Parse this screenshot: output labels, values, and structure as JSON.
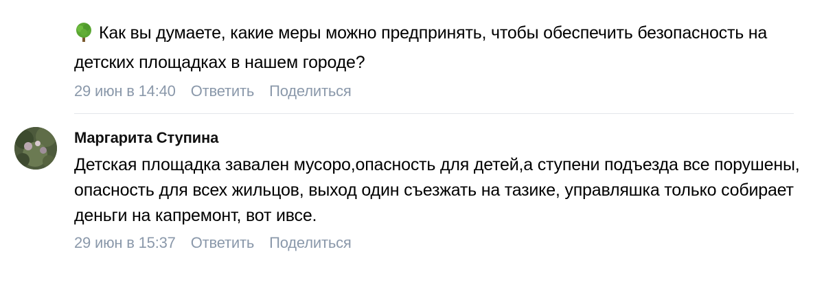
{
  "first_comment": {
    "icon": "tree-icon",
    "text": "Как вы думаете, какие меры можно предпринять, чтобы обеспечить безопасность на детских площадках в нашем городе?",
    "date": "29 июн в 14:40",
    "reply_label": "Ответить",
    "share_label": "Поделиться"
  },
  "second_comment": {
    "author": "Маргарита Ступина",
    "avatar_icon": "avatar-photo",
    "text": "Детская площадка завален мусоро,опасность для детей,а ступени подъезда все порушены, опасность для всех жильцов, выход один съезжать на тазике, управляшка только собирает деньги на капремонт, вот ивсе.",
    "date": "29 июн в 15:37",
    "reply_label": "Ответить",
    "share_label": "Поделиться"
  },
  "colors": {
    "meta_text": "#8a98aa",
    "divider": "#e3e6ea",
    "tree_green": "#4f9a2c"
  }
}
